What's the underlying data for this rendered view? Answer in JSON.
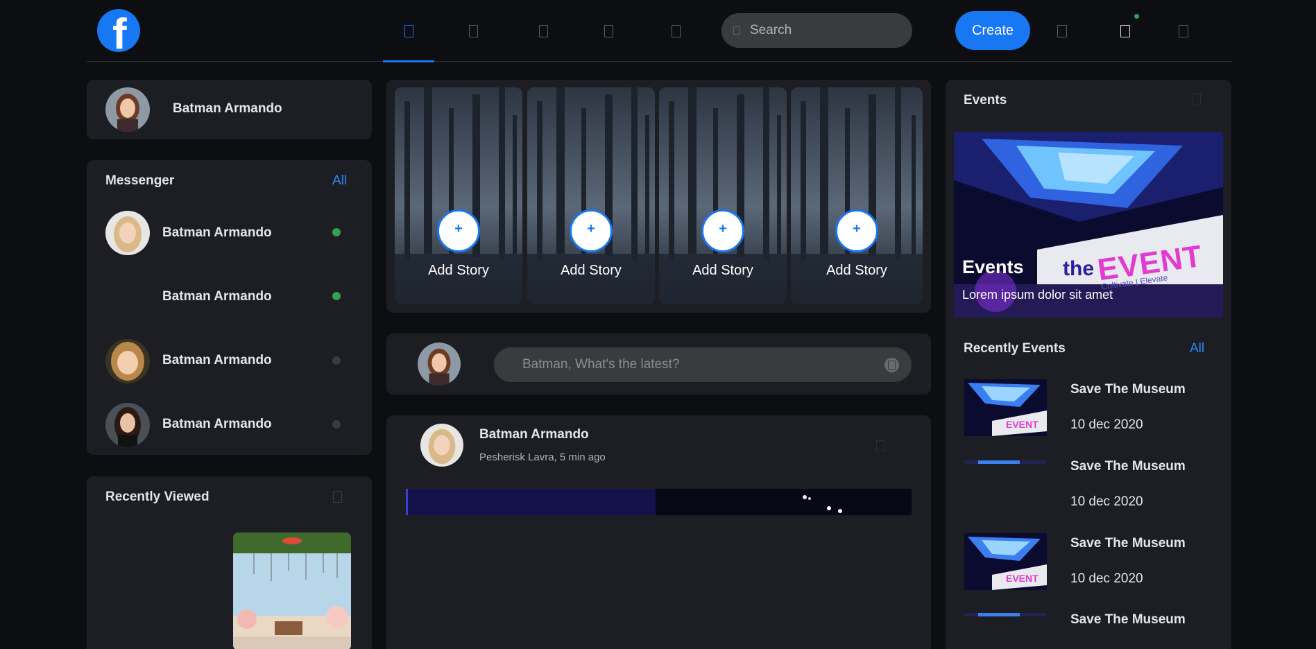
{
  "header": {
    "nav_icons": [
      "home-icon",
      "video-icon",
      "store-icon",
      "groups-icon",
      "gaming-icon"
    ],
    "search": {
      "placeholder": "Search"
    },
    "create_label": "Create",
    "right_icons": [
      "messenger-icon",
      "notifications-icon",
      "menu-icon"
    ],
    "accent": "#1877f2"
  },
  "profile": {
    "name": "Batman Armando"
  },
  "messenger": {
    "title": "Messenger",
    "all_label": "All",
    "contacts": [
      {
        "name": "Batman Armando",
        "online": true
      },
      {
        "name": "Batman Armando",
        "online": true
      },
      {
        "name": "Batman Armando",
        "online": false
      },
      {
        "name": "Batman Armando",
        "online": false
      }
    ],
    "online_color": "#31a24c",
    "offline_color": "#3a3b3c"
  },
  "recently_viewed": {
    "title": "Recently Viewed"
  },
  "stories": [
    {
      "label": "Add Story",
      "plus": "+"
    },
    {
      "label": "Add Story",
      "plus": "+"
    },
    {
      "label": "Add Story",
      "plus": "+"
    },
    {
      "label": "Add Story",
      "plus": "+"
    }
  ],
  "composer": {
    "placeholder": "Batman, What's the latest?"
  },
  "post": {
    "author": "Batman Armando",
    "meta": "Pesherisk Lavra, 5 min ago"
  },
  "events": {
    "title": "Events",
    "banner": {
      "title": "Events",
      "subtitle": "Lorem ipsum dolor sit amet",
      "sign_the": "the",
      "sign_event": "EVENT",
      "sign_tagline": "Cultivate | Elevate"
    },
    "recent_title": "Recently Events",
    "all_label": "All",
    "items": [
      {
        "title": "Save The Museum",
        "date": "10 dec 2020"
      },
      {
        "title": "Save The Museum",
        "date": "10 dec 2020"
      },
      {
        "title": "Save The Museum",
        "date": "10 dec 2020"
      },
      {
        "title": "Save The Museum",
        "date": ""
      }
    ]
  }
}
